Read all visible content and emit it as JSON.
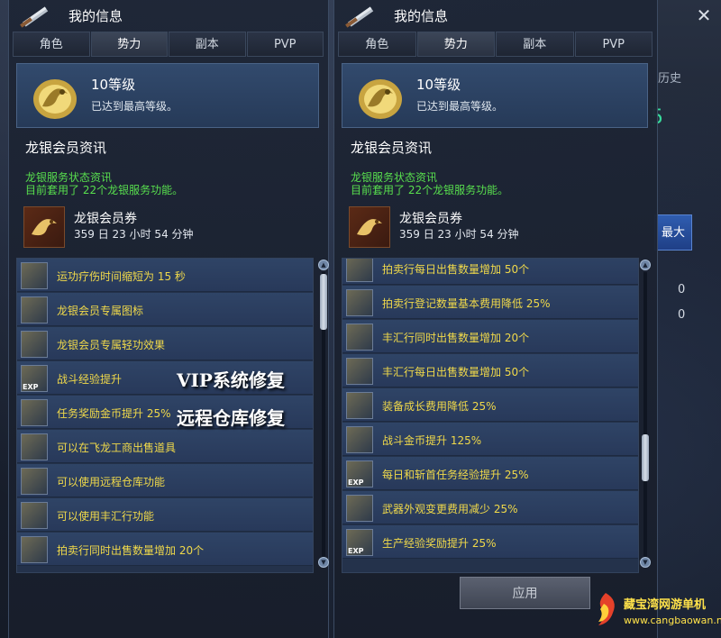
{
  "window": {
    "title": "我的信息",
    "close_label": "✕"
  },
  "tabs": [
    {
      "label": "角色"
    },
    {
      "label": "势力"
    },
    {
      "label": "副本"
    },
    {
      "label": "PVP"
    }
  ],
  "level": {
    "title": "10等级",
    "subtitle": "已达到最高等级。"
  },
  "membership": {
    "section_title": "龙银会员资讯",
    "status_line1": "龙银服务状态资讯",
    "status_line2": "目前套用了 22个龙银服务功能。",
    "coupon_title": "龙银会员券",
    "coupon_time": "359 日 23 小时 54 分钟"
  },
  "left_list": [
    {
      "label": "运功疗伤时间缩短为 15 秒",
      "icon": "meditation-icon"
    },
    {
      "label": "龙银会员专属图标",
      "icon": "dragon-badge-icon"
    },
    {
      "label": "龙银会员专属轻功效果",
      "icon": "qinggong-icon"
    },
    {
      "label": "战斗经验提升",
      "icon": "exp-icon",
      "exp": "EXP"
    },
    {
      "label": "任务奖励金币提升 25%",
      "icon": "money-bag-icon"
    },
    {
      "label": "可以在飞龙工商出售道具",
      "icon": "merchant-icon"
    },
    {
      "label": "可以使用远程仓库功能",
      "icon": "warehouse-icon"
    },
    {
      "label": "可以使用丰汇行功能",
      "icon": "trade-house-icon"
    },
    {
      "label": "拍卖行同时出售数量增加 20个",
      "icon": "auction-icon"
    }
  ],
  "right_list": [
    {
      "label": "拍卖行每日出售数量增加 50个",
      "icon": "auction-icon"
    },
    {
      "label": "拍卖行登记数量基本费用降低 25%",
      "icon": "auction-fee-icon"
    },
    {
      "label": "丰汇行同时出售数量增加 20个",
      "icon": "trade-house-icon"
    },
    {
      "label": "丰汇行每日出售数量增加 50个",
      "icon": "trade-house-icon"
    },
    {
      "label": "装备成长费用降低 25%",
      "icon": "equipment-icon"
    },
    {
      "label": "战斗金币提升 125%",
      "icon": "gold-icon"
    },
    {
      "label": "每日和斩首任务经验提升 25%",
      "icon": "quest-exp-icon",
      "exp": "EXP"
    },
    {
      "label": "武器外观变更费用减少 25%",
      "icon": "weapon-icon"
    },
    {
      "label": "生产经验奖励提升 25%",
      "icon": "craft-exp-icon",
      "exp": "EXP"
    }
  ],
  "overlay": {
    "line1": "VIP系统修复",
    "line2": "远程仓库修复"
  },
  "apply_button": {
    "label": "应用",
    "enabled": false
  },
  "background_window": {
    "tab_fragment": "历史",
    "digit": "5",
    "max_label": "最大",
    "value1": "0",
    "value2": "0"
  },
  "branding": {
    "name": "藏宝湾网游单机",
    "url": "www.cangbaowan.net"
  },
  "colors": {
    "accent_green": "#58df4e",
    "item_text": "#f0d94a",
    "panel_blue": "#2f4466"
  }
}
